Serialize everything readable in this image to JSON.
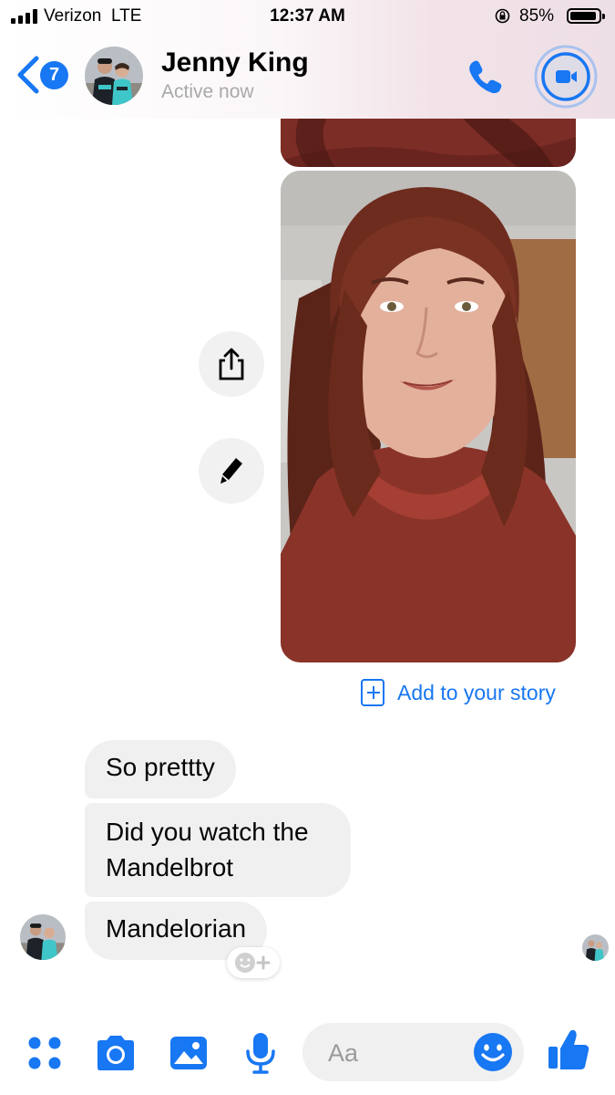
{
  "status_bar": {
    "carrier": "Verizon",
    "network": "LTE",
    "time": "12:37 AM",
    "battery": "85%",
    "icons": [
      "signal-icon",
      "orientation-lock-icon",
      "battery-icon"
    ]
  },
  "header": {
    "back_badge": "7",
    "name": "Jenny King",
    "presence": "Active now",
    "icons": [
      "back-chevron-icon",
      "phone-icon",
      "video-camera-icon"
    ]
  },
  "conversation": {
    "photo_actions": [
      "share-icon",
      "pencil-icon"
    ],
    "add_to_story": "Add to your story",
    "messages": [
      {
        "text": "So prettty"
      },
      {
        "text": "Did you watch the\nMandelbrot"
      },
      {
        "text": "Mandelorian"
      }
    ],
    "reaction_icon": "add-reaction-icon"
  },
  "composer": {
    "placeholder": "Aa",
    "icons": [
      "menu-grid-icon",
      "camera-icon",
      "gallery-icon",
      "microphone-icon",
      "emoji-icon",
      "thumbs-up-icon"
    ]
  },
  "colors": {
    "accent": "#1877f2",
    "bubble": "#f0f0f0",
    "muted_text": "#a9a9a9"
  }
}
